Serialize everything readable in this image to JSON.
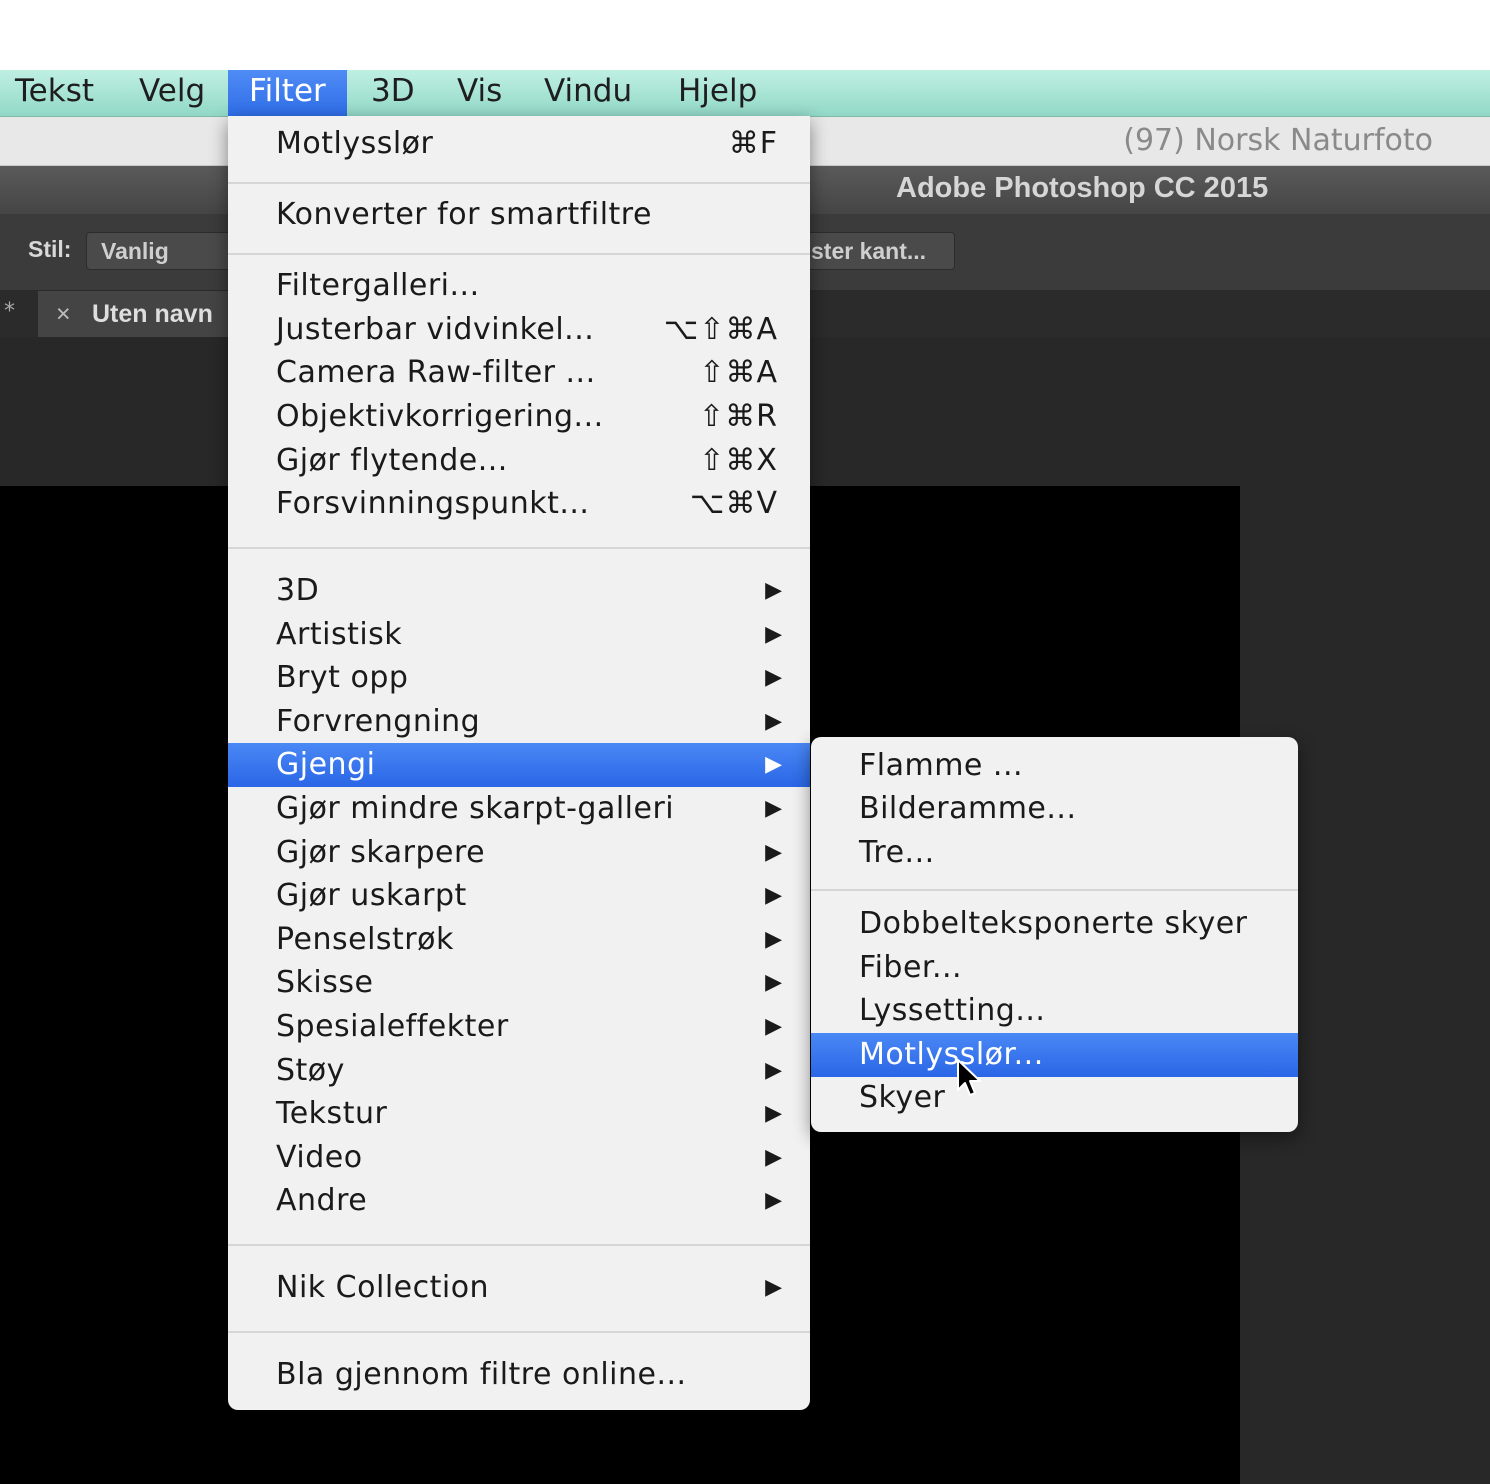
{
  "menubar": {
    "items": [
      "Tekst",
      "Velg",
      "Filter",
      "3D",
      "Vis",
      "Vindu",
      "Hjelp"
    ],
    "active": "Filter"
  },
  "browser": {
    "title": "(97) Norsk Naturfoto"
  },
  "app": {
    "title": "Adobe Photoshop CC 2015"
  },
  "options_bar": {
    "style_label": "Stil:",
    "style_value": "Vanlig",
    "refine_edge": "ster kant..."
  },
  "document": {
    "tab_mark": "*",
    "close_glyph": "×",
    "tab_title": "Uten navn"
  },
  "filter_menu": {
    "last_filter": {
      "label": "Motlysslør",
      "shortcut": "⌘F"
    },
    "smart": "Konverter for smartfiltre",
    "tools": [
      {
        "label": "Filtergalleri...",
        "shortcut": ""
      },
      {
        "label": "Justerbar vidvinkel...",
        "shortcut": "⌥⇧⌘A"
      },
      {
        "label": "Camera Raw-filter ...",
        "shortcut": "⇧⌘A"
      },
      {
        "label": "Objektivkorrigering...",
        "shortcut": "⇧⌘R"
      },
      {
        "label": "Gjør flytende...",
        "shortcut": "⇧⌘X"
      },
      {
        "label": "Forsvinningspunkt...",
        "shortcut": "⌥⌘V"
      }
    ],
    "categories": [
      "3D",
      "Artistisk",
      "Bryt opp",
      "Forvrengning",
      "Gjengi",
      "Gjør mindre skarpt-galleri",
      "Gjør skarpere",
      "Gjør uskarpt",
      "Penselstrøk",
      "Skisse",
      "Spesialeffekter",
      "Støy",
      "Tekstur",
      "Video",
      "Andre"
    ],
    "highlighted_category": "Gjengi",
    "plugin": "Nik Collection",
    "browse": "Bla gjennom filtre online...",
    "submenu_arrow": "▶"
  },
  "gjengi_submenu": {
    "items": [
      "Flamme ...",
      "Bilderamme...",
      "Tre...",
      "Dobbelteksponerte skyer",
      "Fiber...",
      "Lyssetting...",
      "Motlysslør...",
      "Skyer"
    ],
    "highlighted": "Motlysslør..."
  },
  "colors": {
    "menubar": "#a8e5d6",
    "highlight": "#3a78ee",
    "menu_bg": "#f1f1f1",
    "ps_dark": "#282828"
  }
}
